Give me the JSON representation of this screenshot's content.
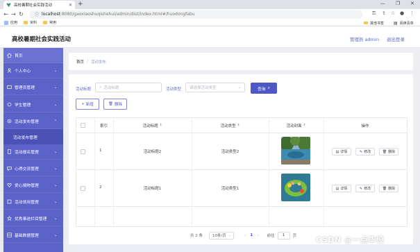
{
  "browser": {
    "tab_title": "高校暑期社会实践活动",
    "url_host": "localhost",
    "url_path": ":8080/gaoxiaoshuqishehui/admin/dist/index.html#/huodongfabu",
    "bookmarks": [
      "应用",
      "资料",
      "常用"
    ],
    "bookmark_right": [
      "其他书签",
      "阅读清单"
    ]
  },
  "header": {
    "title": "高校暑期社会实践活动",
    "admin": "管理员 admin",
    "logout": "退出登录"
  },
  "sidebar": {
    "items": [
      {
        "label": "首页",
        "icon": "home-icon"
      },
      {
        "label": "个人中心",
        "icon": "user-icon"
      },
      {
        "label": "管理员管理",
        "icon": "admin-icon"
      },
      {
        "label": "学生管理",
        "icon": "student-icon"
      },
      {
        "label": "活动发布管理",
        "icon": "activity-icon"
      },
      {
        "label": "活动发布管理",
        "icon": ""
      },
      {
        "label": "活动报名管理",
        "icon": "signup-icon"
      },
      {
        "label": "心得交流管理",
        "icon": "exchange-icon"
      },
      {
        "label": "爱心捐物管理",
        "icon": "donate-icon"
      },
      {
        "label": "活动领用管理",
        "icon": "claim-icon"
      },
      {
        "label": "优秀事迹栏目管理",
        "icon": "honor-icon"
      },
      {
        "label": "基础数据管理",
        "icon": "data-icon"
      }
    ]
  },
  "breadcrumb": {
    "home": "首页",
    "sep": "/",
    "current": "活动发布"
  },
  "search": {
    "title_label": "活动标题",
    "title_placeholder": "活动标题",
    "type_label": "活动类型",
    "type_placeholder": "请选择活动类型",
    "button": "查询"
  },
  "actions": {
    "add": "新增",
    "delete": "删除"
  },
  "table": {
    "headers": [
      "索引",
      "活动标题",
      "活动类型",
      "活动封面",
      "操作"
    ],
    "rows": [
      {
        "index": "1",
        "title": "活动标题2",
        "type": "活动类型2",
        "cover": "pool-photo"
      },
      {
        "index": "2",
        "title": "活动标题1",
        "type": "活动类型1",
        "cover": "float-photo"
      }
    ],
    "ops": {
      "detail": "详情",
      "edit": "修改",
      "delete": "删除"
    }
  },
  "pager": {
    "total": "共 2 条",
    "page_size": "10条/页",
    "current": "1",
    "goto": "前往",
    "goto_value": "1",
    "page_unit": "页"
  },
  "watermark": "CSDN @一点毕设",
  "colors": {
    "sidebar": "#5c63c8",
    "accent": "#4e58c4",
    "link": "#5a6fc4"
  }
}
